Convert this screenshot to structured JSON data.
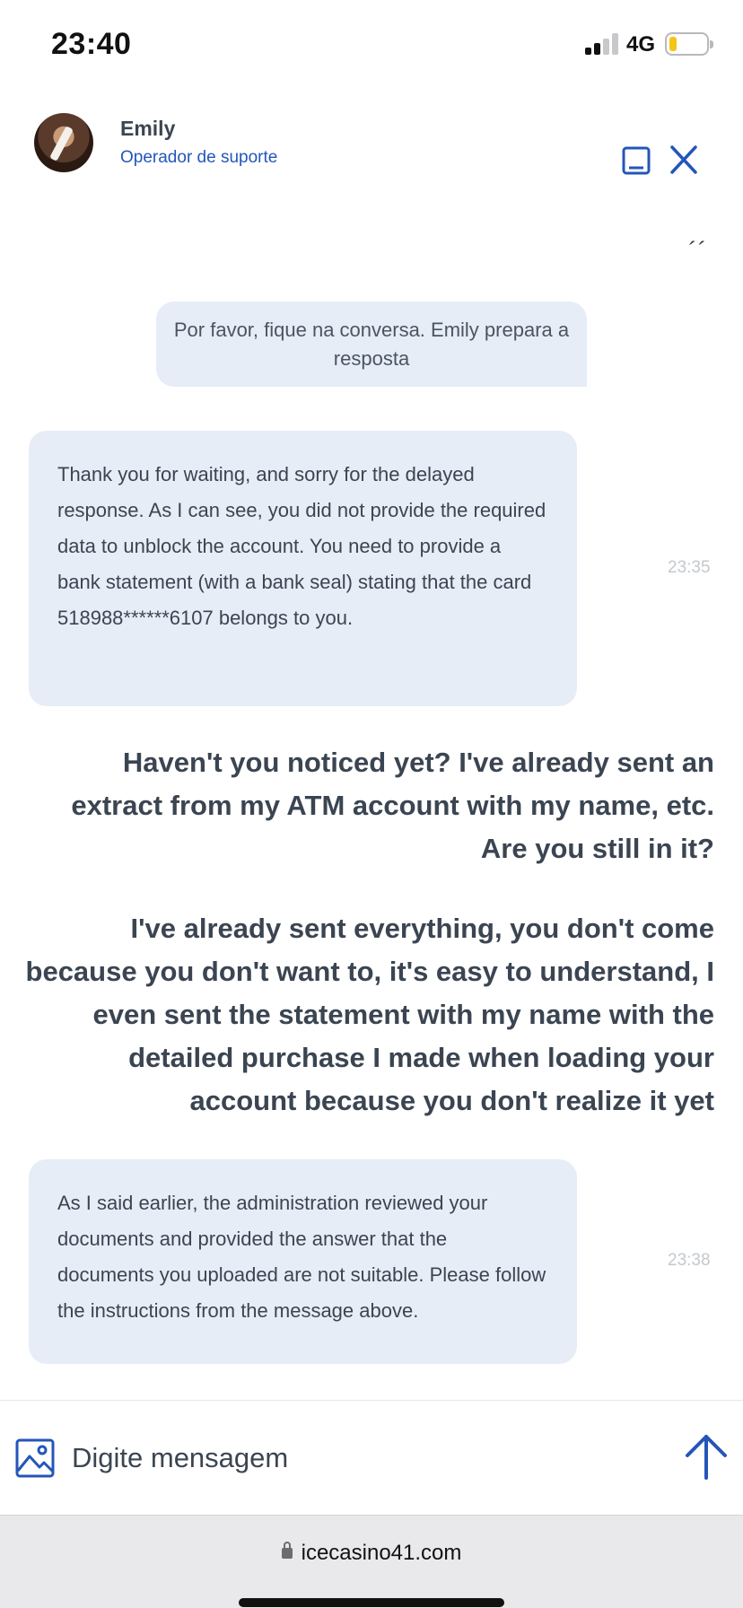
{
  "status_bar": {
    "time": "23:40",
    "network": "4G"
  },
  "header": {
    "agent_name": "Emily",
    "agent_role": "Operador de suporte"
  },
  "typing_indicator": "´´",
  "messages": {
    "system": "Por favor, fique na conversa. Emily prepara a resposta",
    "agent_1": {
      "text": "Thank you for waiting, and sorry for the delayed response. As I can see, you did not provide the required data to unblock the account. You need to provide a bank statement (with a bank seal) stating that the card 518988******6107 belongs to you.",
      "time": "23:35"
    },
    "user_1": "Haven't you noticed yet? I've already sent an extract from my ATM account with my name, etc. Are you still in it?",
    "user_2": "I've already sent everything, you don't come because you don't want to, it's easy to understand, I even sent the statement with my name with the detailed purchase I made when loading your account because you don't realize it yet",
    "agent_2": {
      "text": "As I said earlier, the administration reviewed your documents and provided the answer that the documents you uploaded are not suitable. Please follow the instructions from the message above.",
      "time": "23:38"
    }
  },
  "composer": {
    "placeholder": "Digite mensagem"
  },
  "browser": {
    "url": "icecasino41.com"
  },
  "colors": {
    "accent": "#2456b8",
    "bubble": "#e6edf7",
    "text": "#3b4552",
    "battery": "#f5c518"
  },
  "icons": [
    "signal-icon",
    "battery-icon",
    "minimize-icon",
    "close-icon",
    "image-attach-icon",
    "send-arrow-icon",
    "lock-icon"
  ]
}
